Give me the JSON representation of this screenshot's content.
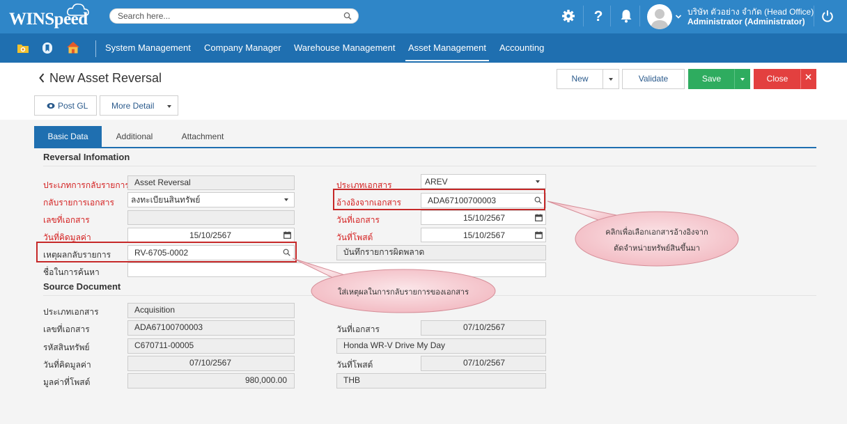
{
  "app": {
    "logo": "WINSpeed"
  },
  "search": {
    "placeholder": "Search here..."
  },
  "user": {
    "company": "บริษัท ตัวอย่าง จำกัด (Head Office)",
    "name": "Administrator (Administrator)"
  },
  "nav": {
    "items": [
      "System Management",
      "Company Manager",
      "Warehouse Management",
      "Asset Management",
      "Accounting"
    ],
    "active": "Asset Management"
  },
  "page": {
    "title": "New Asset Reversal"
  },
  "toolbar": {
    "new": "New",
    "validate": "Validate",
    "save": "Save",
    "close": "Close",
    "post_gl": "Post GL",
    "more_detail": "More Detail"
  },
  "tabs": [
    "Basic Data",
    "Additional",
    "Attachment"
  ],
  "reversal": {
    "title": "Reversal Infomation",
    "reversal_type_label": "ประเภทการกลับรายการ",
    "reversal_type_value": "Asset Reversal",
    "reverse_doc_label": "กลับรายการเอกสาร",
    "reverse_doc_value": "ลงทะเบียนสินทรัพย์",
    "doc_no_label": "เลขที่เอกสาร",
    "doc_no_value": "",
    "calc_date_label": "วันที่คิดมูลค่า",
    "calc_date_value": "15/10/2567",
    "reason_label": "เหตุผลกลับรายการ",
    "reason_value": "RV-6705-0002",
    "search_name_label": "ชื่อในการค้นหา",
    "search_name_value": "",
    "doc_type_label": "ประเภทเอกสาร",
    "doc_type_value": "AREV",
    "ref_doc_label": "อ้างอิงจากเอกสาร",
    "ref_doc_value": "ADA67100700003",
    "doc_date_label": "วันที่เอกสาร",
    "doc_date_value": "15/10/2567",
    "post_date_label": "วันที่โพสต์",
    "post_date_value": "15/10/2567",
    "error_note": "บันทึกรายการผิดพลาด"
  },
  "source": {
    "title": "Source Document",
    "doc_type_label": "ประเภทเอกสาร",
    "doc_type_value": "Acquisition",
    "doc_no_label": "เลขที่เอกสาร",
    "doc_no_value": "ADA67100700003",
    "asset_code_label": "รหัสสินทรัพย์",
    "asset_code_value": "C670711-00005",
    "calc_date_label": "วันที่คิดมูลค่า",
    "calc_date_value": "07/10/2567",
    "post_value_label": "มูลค่าที่โพสต์",
    "post_value_value": "980,000.00",
    "doc_date_label": "วันที่เอกสาร",
    "doc_date_value": "07/10/2567",
    "asset_name": "Honda WR-V Drive My Day",
    "post_date_label": "วันที่โพสต์",
    "post_date_value": "07/10/2567",
    "currency": "THB"
  },
  "callouts": {
    "reason": "ใส่เหตุผลในการกลับรายการของเอกสาร",
    "ref_line1": "คลิกเพื่อเลือกเอกสารอ้างอิงจาก",
    "ref_line2": "ตัดจำหน่ายทรัพย์สินขึ้นมา"
  },
  "colors": {
    "header": "#2f86c8",
    "nav": "#1f6fb0",
    "save": "#2eac5f",
    "close": "#e3403f",
    "required": "#d42020",
    "highlight": "#c62828",
    "callout": "#f6c9cf"
  },
  "icons": [
    "cloud-icon",
    "search-icon",
    "gear-icon",
    "help-icon",
    "bell-icon",
    "avatar-icon",
    "chevron-down-icon",
    "power-icon",
    "folder-icon",
    "bookmark-icon",
    "home-icon",
    "back-arrow-icon",
    "eye-icon",
    "calendar-icon",
    "dropdown-arrow-icon"
  ]
}
